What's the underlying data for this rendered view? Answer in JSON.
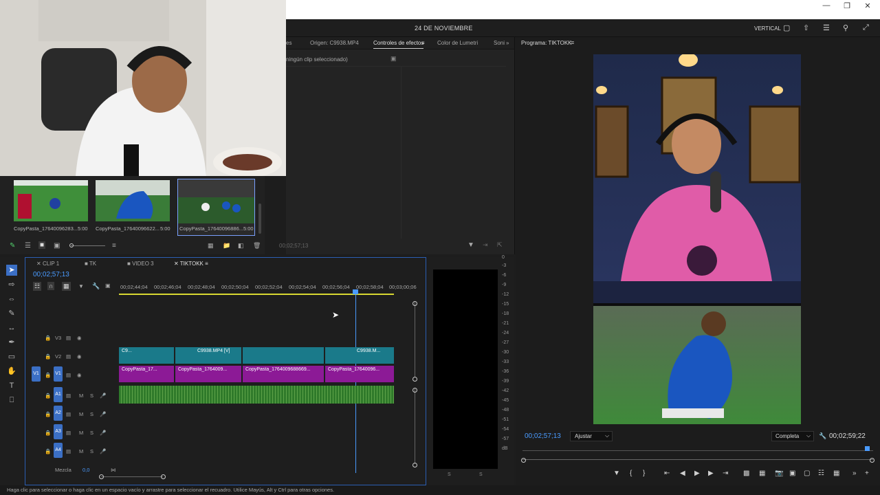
{
  "header": {
    "date": "24 DE NOVIEMBRE",
    "workspace": "VERTICAL"
  },
  "effects_panel": {
    "tabs": [
      "es",
      "Origen: C9938.MP4",
      "Controles de efectos",
      "Color de Lumetri",
      "Soni"
    ],
    "active_tab": "Controles de efectos",
    "no_clip": "ningún clip seleccionado)",
    "timecode": "00;02;57;13"
  },
  "program": {
    "title": "Programa: TIKTOKK",
    "timecode_current": "00;02;57;13",
    "fit": "Ajustar",
    "quality": "Completa",
    "timecode_total": "00;02;59;22"
  },
  "bin": {
    "clips": [
      {
        "name": "CopyPasta_17640096283...",
        "duration": "5:00"
      },
      {
        "name": "CopyPasta_17640096622...",
        "duration": "5:00"
      },
      {
        "name": "CopyPasta_17640096886...",
        "duration": "5:00"
      }
    ]
  },
  "timeline": {
    "tabs": [
      "CLIP 1",
      "TK",
      "VIDEO 3",
      "TIKTOKK"
    ],
    "active_tab": "TIKTOKK",
    "timecode": "00;02;57;13",
    "ruler": [
      "00;02;44;04",
      "00;02;46;04",
      "00;02;48;04",
      "00;02;50;04",
      "00;02;52;04",
      "00;02;54;04",
      "00;02;56;04",
      "00;02;58;04",
      "00;03;00;06"
    ],
    "tracks": {
      "v3": "V3",
      "v2": "V2",
      "v1": "V1",
      "a1": "A1",
      "a2": "A2",
      "a3": "A3",
      "a4": "A4"
    },
    "mix_label": "Mezcla",
    "mix_value": "0,0",
    "clips_v2": [
      "C9...",
      "C9938.MP4 [V]",
      "C9938.M..."
    ],
    "clips_v1": [
      "CopyPasta_17...",
      "CopyPasta_1764009...",
      "CopyPasta_1764009688669...",
      "CopyPasta_17640096..."
    ]
  },
  "meter": {
    "scale": [
      "0",
      "-3",
      "-6",
      "-9",
      "-12",
      "-15",
      "-18",
      "-21",
      "-24",
      "-27",
      "-30",
      "-33",
      "-36",
      "-39",
      "-42",
      "-45",
      "-48",
      "-51",
      "-54",
      "-57",
      "dB"
    ],
    "channels": [
      "S",
      "S"
    ]
  },
  "status": "Haga clic para seleccionar o haga clic en un espacio vacío y arrastre para seleccionar el recuadro. Utilice Mayús, Alt y Ctrl para otras opciones."
}
